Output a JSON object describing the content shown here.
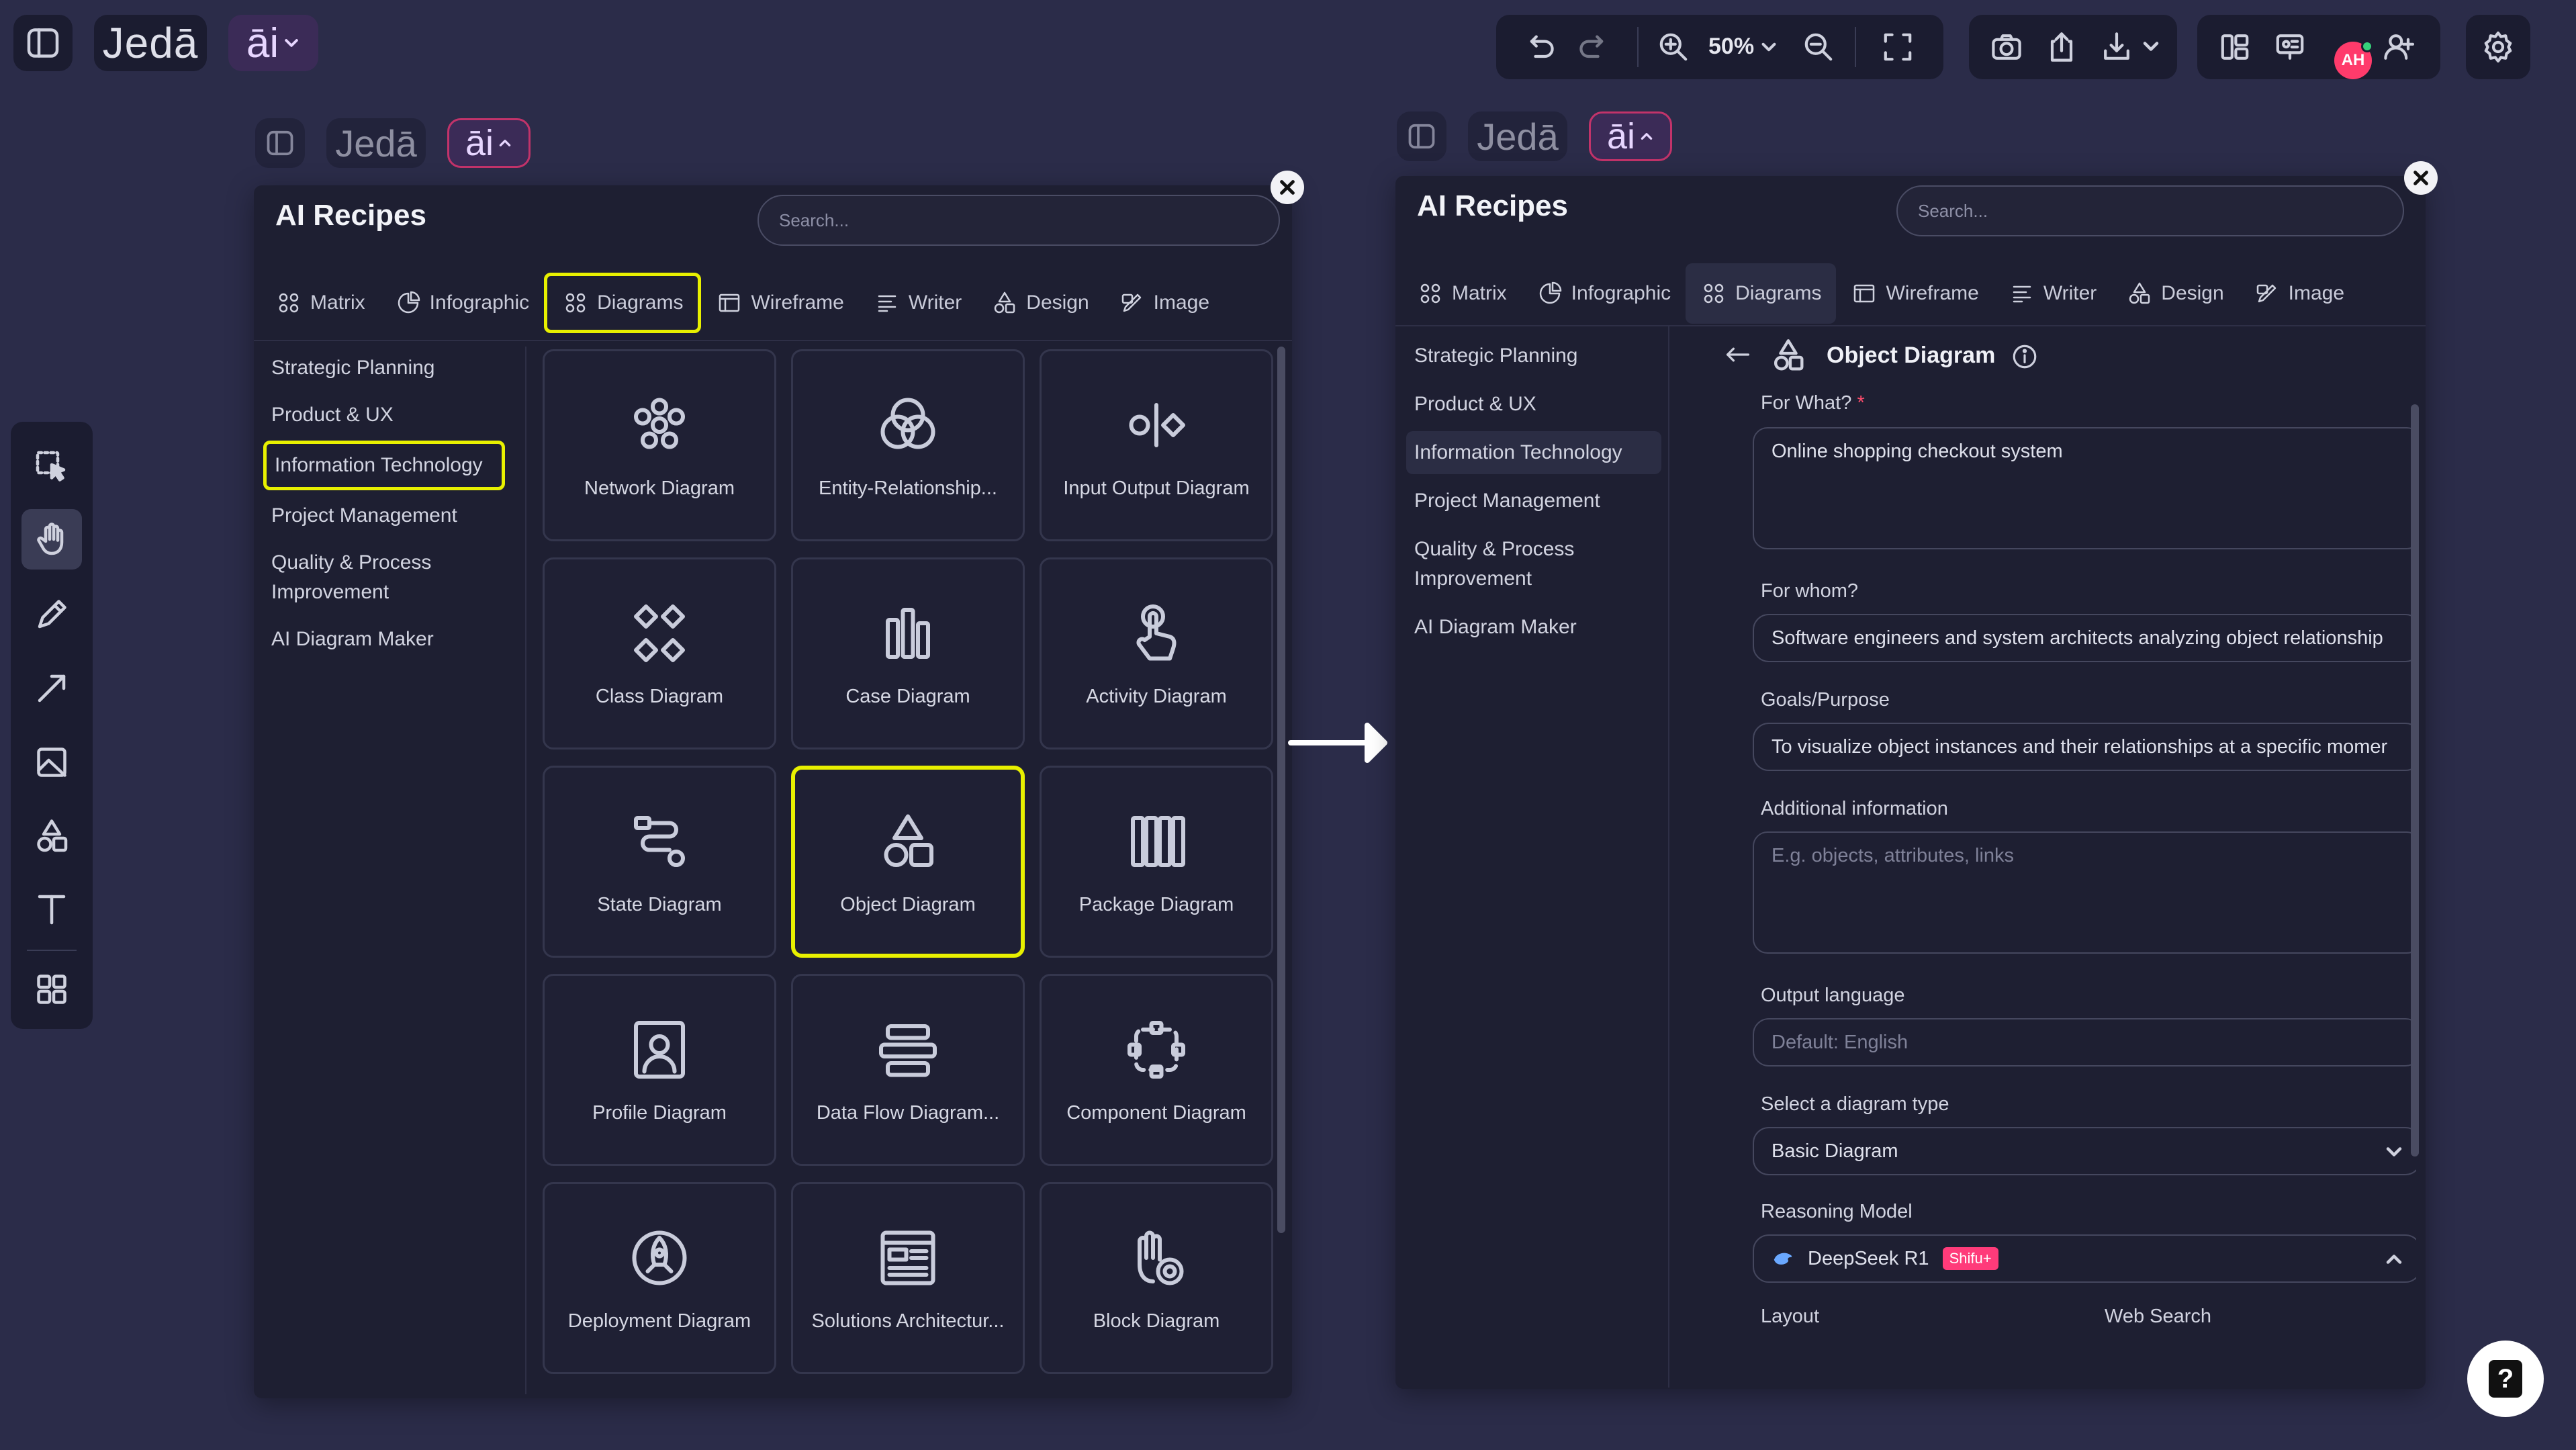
{
  "app": {
    "brand": "Jedā",
    "ai_label": "āi"
  },
  "topbar": {
    "zoom": "50%"
  },
  "avatar_initials": "AH",
  "left_panel": {
    "title": "AI Recipes",
    "search_placeholder": "Search...",
    "tabs": [
      "Matrix",
      "Infographic",
      "Diagrams",
      "Wireframe",
      "Writer",
      "Design",
      "Image"
    ],
    "categories": [
      "Strategic Planning",
      "Product & UX",
      "Information Technology",
      "Project Management",
      "Quality & Process Improvement",
      "AI Diagram Maker"
    ],
    "cards": [
      "Network Diagram",
      "Entity-Relationship...",
      "Input Output Diagram",
      "Class Diagram",
      "Case Diagram",
      "Activity Diagram",
      "State Diagram",
      "Object Diagram",
      "Package Diagram",
      "Profile Diagram",
      "Data Flow Diagram...",
      "Component Diagram",
      "Deployment Diagram",
      "Solutions Architectur...",
      "Block Diagram"
    ]
  },
  "right_panel": {
    "title": "AI Recipes",
    "search_placeholder": "Search...",
    "tabs": [
      "Matrix",
      "Infographic",
      "Diagrams",
      "Wireframe",
      "Writer",
      "Design",
      "Image"
    ],
    "categories": [
      "Strategic Planning",
      "Product & UX",
      "Information Technology",
      "Project Management",
      "Quality & Process Improvement",
      "AI Diagram Maker"
    ],
    "form": {
      "title": "Object Diagram",
      "for_what_label": "For What?",
      "for_what_required": "*",
      "for_what_value": "Online shopping checkout system",
      "for_whom_label": "For whom?",
      "for_whom_value": "Software engineers and system architects analyzing object relationship",
      "goals_label": "Goals/Purpose",
      "goals_value": "To visualize object instances and their relationships at a specific momer",
      "additional_label": "Additional information",
      "additional_placeholder": "E.g. objects, attributes, links",
      "output_language_label": "Output language",
      "output_language_placeholder": "Default: English",
      "diagram_type_label": "Select a diagram type",
      "diagram_type_value": "Basic Diagram",
      "reasoning_label": "Reasoning Model",
      "reasoning_value": "DeepSeek R1",
      "reasoning_badge": "Shifu+",
      "layout_label": "Layout",
      "web_search_label": "Web Search"
    }
  },
  "help_label": "?",
  "colors": {
    "background": "#2b2c49",
    "panel": "#1e1f32",
    "highlight": "#e8f000",
    "accent_pink": "#ff3b7a"
  }
}
